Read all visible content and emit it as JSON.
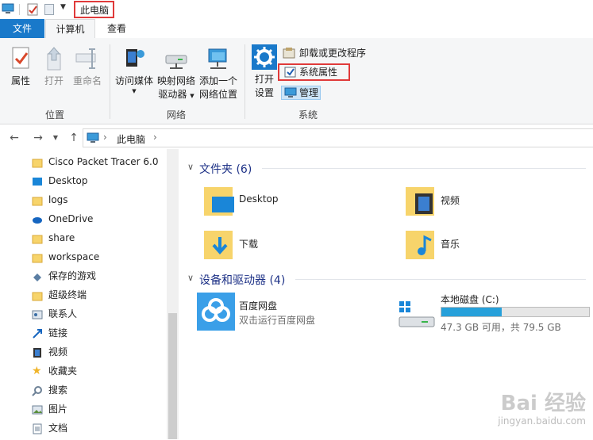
{
  "title_bar": {
    "title": "此电脑"
  },
  "tabs": {
    "file": "文件",
    "computer": "计算机",
    "view": "查看"
  },
  "ribbon": {
    "location_group": "位置",
    "network_group": "网络",
    "system_group": "系统",
    "properties": "属性",
    "open": "打开",
    "rename": "重命名",
    "access_media": "访问媒体",
    "map_drive_1": "映射网络",
    "map_drive_2": "驱动器",
    "add_location_1": "添加一个",
    "add_location_2": "网络位置",
    "open_settings_1": "打开",
    "open_settings_2": "设置",
    "uninstall": "卸载或更改程序",
    "system_properties": "系统属性",
    "manage": "管理"
  },
  "address": {
    "path": "此电脑"
  },
  "nav": {
    "items": [
      {
        "label": "Cisco Packet Tracer 6.0",
        "icon": "folder-icon"
      },
      {
        "label": "Desktop",
        "icon": "desktop-icon"
      },
      {
        "label": "logs",
        "icon": "folder-icon"
      },
      {
        "label": "OneDrive",
        "icon": "onedrive-icon"
      },
      {
        "label": "share",
        "icon": "folder-icon"
      },
      {
        "label": "workspace",
        "icon": "folder-icon"
      },
      {
        "label": "保存的游戏",
        "icon": "games-icon"
      },
      {
        "label": "超级终端",
        "icon": "folder-icon"
      },
      {
        "label": "联系人",
        "icon": "contacts-icon"
      },
      {
        "label": "链接",
        "icon": "links-icon"
      },
      {
        "label": "视频",
        "icon": "video-icon"
      },
      {
        "label": "收藏夹",
        "icon": "star-icon"
      },
      {
        "label": "搜索",
        "icon": "search-icon"
      },
      {
        "label": "图片",
        "icon": "pictures-icon"
      },
      {
        "label": "文档",
        "icon": "documents-icon"
      }
    ]
  },
  "folders": {
    "header": "文件夹 (6)",
    "items": [
      {
        "label": "Desktop"
      },
      {
        "label": "视频"
      },
      {
        "label": "下载"
      },
      {
        "label": "音乐"
      }
    ]
  },
  "devices": {
    "header": "设备和驱动器 (4)",
    "baidu_name": "百度网盘",
    "baidu_sub": "双击运行百度网盘",
    "drive_name": "本地磁盘 (C:)",
    "drive_usage": "47.3 GB 可用，共 79.5 GB",
    "drive_fill_fraction": 0.41
  },
  "watermark": {
    "text": "Bai 经验",
    "url": "jingyan.baidu.com"
  },
  "colors": {
    "accent": "#1979ca",
    "highlight_box": "#e03a3a",
    "drive_fill": "#26a0da"
  }
}
